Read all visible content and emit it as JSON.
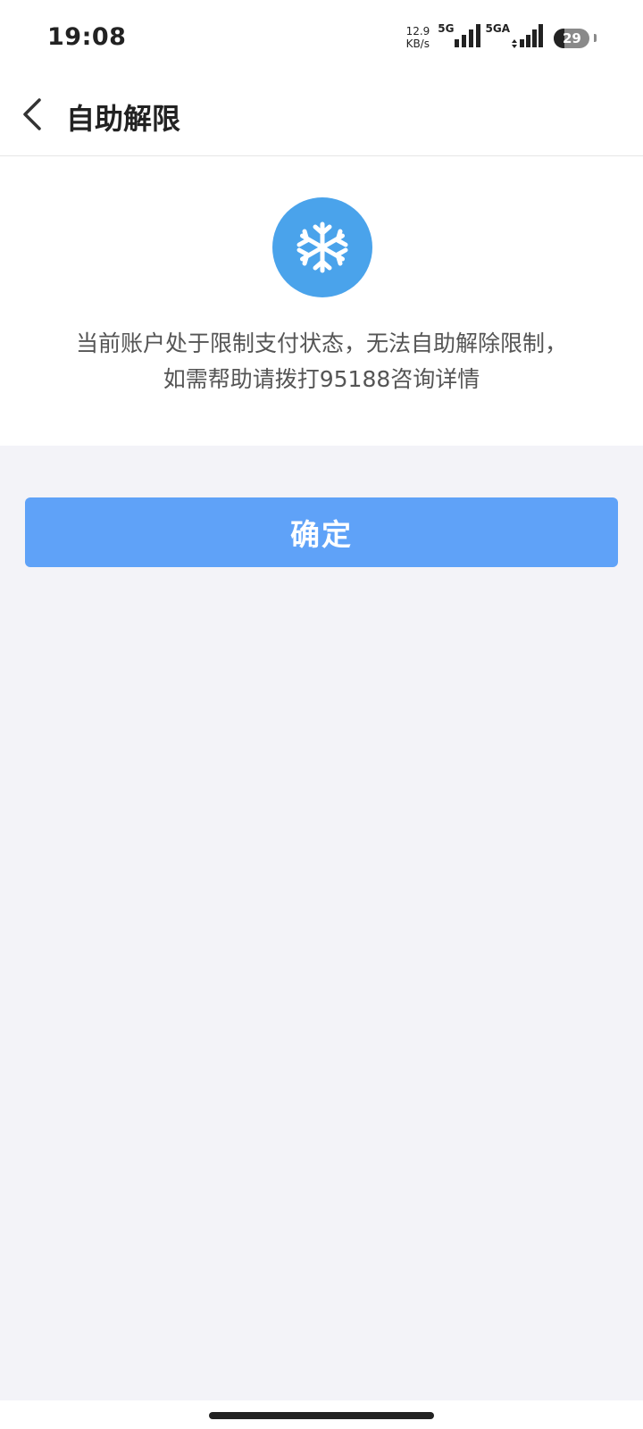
{
  "status_bar": {
    "time": "19:08",
    "net_speed_value": "12.9",
    "net_speed_unit": "KB/s",
    "signal1_label": "5G",
    "signal2_label": "5GA",
    "battery_level": "29"
  },
  "nav": {
    "back_icon": "chevron-left-icon",
    "title": "自助解限"
  },
  "info": {
    "icon": "snowflake-icon",
    "icon_color": "#4AA3EB",
    "message_line1": "当前账户处于限制支付状态，无法自助解除限制，",
    "message_line2": "如需帮助请拨打95188咨询详情"
  },
  "actions": {
    "confirm_label": "确定",
    "confirm_color": "#5FA2F8"
  }
}
